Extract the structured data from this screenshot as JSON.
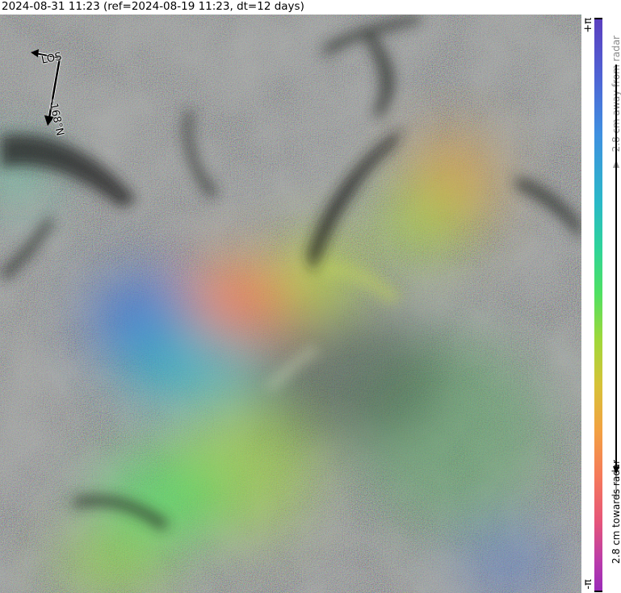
{
  "header": {
    "title": "2024-08-31 11:23 (ref=2024-08-19 11:23, dt=12 days)"
  },
  "compass": {
    "los_label": "LOS",
    "heading_label": "-168°N"
  },
  "colorbar": {
    "top_label": "+π",
    "bottom_label": "-π",
    "away_label": "2.8 cm away from radar",
    "toward_label": "2.8 cm towards radar",
    "colors": [
      "#5b3fbf",
      "#3f8fe0",
      "#2ed39a",
      "#4fe062",
      "#d6c238",
      "#f5795a",
      "#b93bab"
    ]
  },
  "map": {
    "description_colors": {
      "noise_base": "#6b6f6e",
      "shadow": "#2b2d2c",
      "highlight": "#a9aba8"
    }
  }
}
